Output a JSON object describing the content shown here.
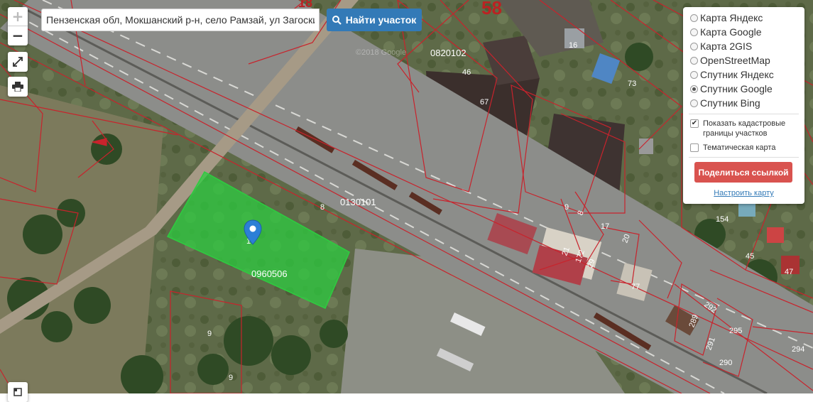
{
  "search": {
    "value": "Пензенская обл, Мокшанский р-н, село Рамзай, ул Загоскина",
    "button_label": "Найти участок",
    "button_icon": "search-icon"
  },
  "controls": {
    "zoom_in": "+",
    "zoom_out": "−",
    "fullscreen_icon": "expand-icon",
    "print_icon": "printer-icon"
  },
  "panel": {
    "map_sources": [
      {
        "label": "Карта Яндекс",
        "selected": false
      },
      {
        "label": "Карта Google",
        "selected": false
      },
      {
        "label": "Карта 2GIS",
        "selected": false
      },
      {
        "label": "OpenStreetMap",
        "selected": false
      },
      {
        "label": "Спутник Яндекс",
        "selected": false
      },
      {
        "label": "Спутник Google",
        "selected": true
      },
      {
        "label": "Спутник Bing",
        "selected": false
      }
    ],
    "show_cadastral": {
      "label": "Показать кадастровые границы участков",
      "checked": true
    },
    "thematic_map": {
      "label": "Тематическая карта",
      "checked": false
    },
    "share_button": "Поделиться ссылкой",
    "configure_link": "Настроить карту"
  },
  "map": {
    "quarter_labels": [
      "58",
      "18",
      "0820102",
      "0130101",
      "0960506"
    ],
    "parcel_labels": [
      "16",
      "46",
      "73",
      "67",
      "8",
      "9",
      "8",
      "17",
      "20",
      "21",
      "172",
      "29",
      "77",
      "154",
      "45",
      "47",
      "292",
      "295",
      "289",
      "291",
      "290",
      "294",
      "9",
      "9",
      "1"
    ],
    "watermarks": [
      "©2018 Google"
    ],
    "colors": {
      "boundary": "#c8232c",
      "selected_parcel": "#2ecc40",
      "marker": "#2c7fd6",
      "accent": "#337ab7",
      "share": "#d9534f"
    }
  }
}
